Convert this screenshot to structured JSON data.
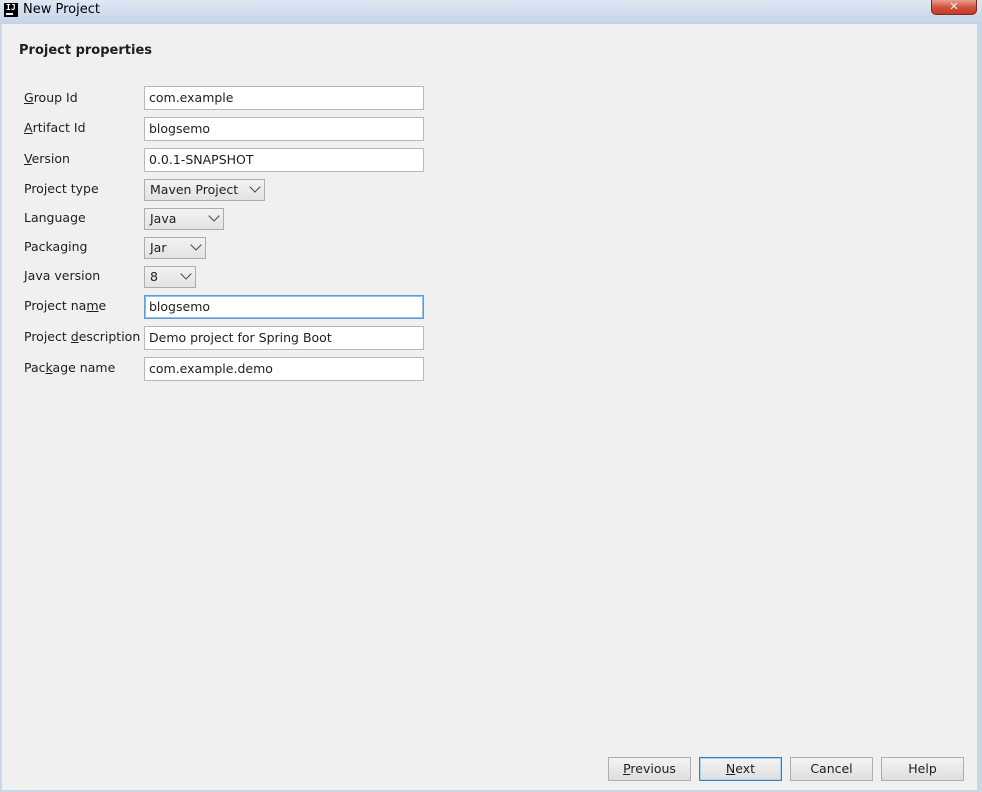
{
  "window": {
    "title": "New Project",
    "app_icon": "IJ",
    "close_glyph": "✕"
  },
  "section": {
    "heading": "Project properties"
  },
  "form": {
    "group_id": {
      "label_prefix": "",
      "label_mnemonic": "G",
      "label_rest": "roup Id",
      "value": "com.example"
    },
    "artifact_id": {
      "label_prefix": "",
      "label_mnemonic": "A",
      "label_rest": "rtifact Id",
      "value": "blogsemo"
    },
    "version": {
      "label_prefix": "",
      "label_mnemonic": "V",
      "label_rest": "ersion",
      "value": "0.0.1-SNAPSHOT"
    },
    "project_type": {
      "label": "Project type",
      "value": "Maven Project"
    },
    "language": {
      "label": "Language",
      "value": "Java"
    },
    "packaging": {
      "label": "Packaging",
      "value": "Jar"
    },
    "java_version": {
      "label": "Java version",
      "value": "8"
    },
    "project_name": {
      "label_prefix": "Project na",
      "label_mnemonic": "m",
      "label_rest": "e",
      "value": "blogsemo"
    },
    "project_description": {
      "label_prefix": "Project ",
      "label_mnemonic": "d",
      "label_rest": "escription",
      "value": "Demo project for Spring Boot"
    },
    "package_name": {
      "label_prefix": "Pac",
      "label_mnemonic": "k",
      "label_rest": "age name",
      "value": "com.example.demo"
    }
  },
  "buttons": {
    "previous": {
      "mnemonic": "P",
      "rest": "revious"
    },
    "next": {
      "mnemonic": "N",
      "rest": "ext"
    },
    "cancel": {
      "label": "Cancel"
    },
    "help": {
      "label": "Help"
    }
  },
  "colors": {
    "focus_border": "#5b9ed6",
    "titlebar": "#cfdced",
    "close_button": "#c94a33"
  }
}
